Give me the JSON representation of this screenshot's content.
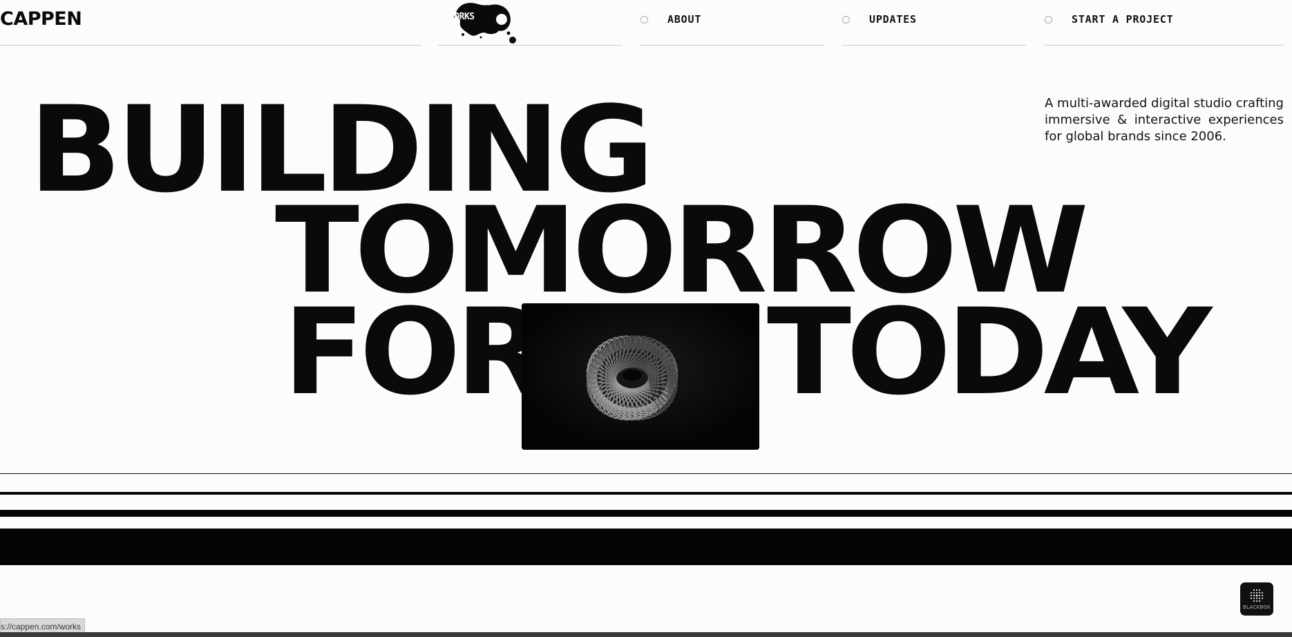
{
  "header": {
    "logo": "CAPPEN",
    "nav": [
      {
        "label": "WORKS"
      },
      {
        "label": "ABOUT"
      },
      {
        "label": "UPDATES"
      },
      {
        "label": "START A PROJECT"
      }
    ]
  },
  "hero": {
    "lines": [
      "BUILDING",
      "TOMORROW",
      "FOR",
      "TODAY"
    ],
    "tagline": "A multi-awarded digital studio crafting immersive & interactive experiences for global brands since 2006."
  },
  "status_bar": {
    "url": "s://cappen.com/works"
  },
  "widget": {
    "label": "BLACKBOX"
  },
  "colors": {
    "background": "#fcfcfc",
    "ink": "#0a0a0a"
  },
  "icons": [
    "nav-dot-icon",
    "ink-splat-icon",
    "spiral-sculpture-image",
    "blackbox-grid-icon"
  ]
}
